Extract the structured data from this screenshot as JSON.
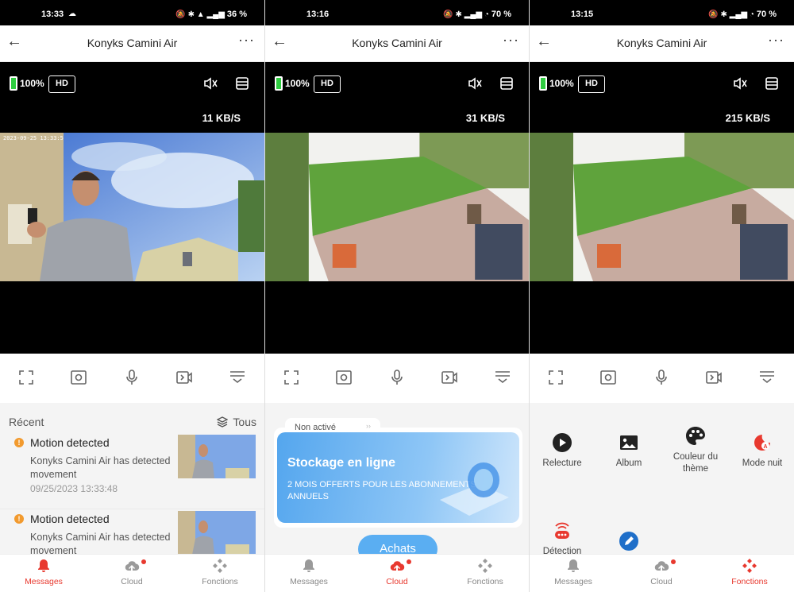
{
  "app": {
    "title": "Konyks Camini Air",
    "back_glyph": "←",
    "more_glyph": "···"
  },
  "colors": {
    "accent": "#e8392f",
    "battery": "#2ecc40",
    "cloud_button": "#5aaef2",
    "warning": "#f29a2e"
  },
  "screens": [
    {
      "status": {
        "time": "13:33",
        "extra": "☁",
        "glyphs": "🔕 ✱ ▲ ▂▄▆",
        "battery": "36 %"
      },
      "video": {
        "battery": "100%",
        "quality": "HD",
        "speed": "11 KB/S",
        "timestamp": "2023-09-25 13:33:5"
      }
    },
    {
      "status": {
        "time": "13:16",
        "extra": "",
        "glyphs": "🔕 ✱ ▂▄▆ ◔",
        "battery": "70 %"
      },
      "video": {
        "battery": "100%",
        "quality": "HD",
        "speed": "31 KB/S",
        "timestamp": ""
      }
    },
    {
      "status": {
        "time": "13:15",
        "extra": "",
        "glyphs": "🔕 ✱ ▂▄▆ ◔",
        "battery": "70 %"
      },
      "video": {
        "battery": "100%",
        "quality": "HD",
        "speed": "215 KB/S",
        "timestamp": ""
      }
    }
  ],
  "messages_view": {
    "section_label": "Récent",
    "filter_label": "Tous",
    "warn_glyph": "!",
    "items": [
      {
        "title": "Motion detected",
        "body": "Konyks Camini Air has detected movement",
        "time": "09/25/2023 13:33:48"
      },
      {
        "title": "Motion detected",
        "body": "Konyks Camini Air has detected movement",
        "time": ""
      }
    ]
  },
  "cloud_view": {
    "status_tab": "Non activé",
    "tab_chevron": "››",
    "card_title": "Stockage en ligne",
    "card_subtitle": "2 MOIS OFFERTS POUR LES ABONNEMENTS ANNUELS",
    "button": "Achats"
  },
  "functions_view": {
    "items": [
      {
        "label": "Relecture",
        "icon": "play-circle-icon"
      },
      {
        "label": "Album",
        "icon": "image-icon"
      },
      {
        "label": "Couleur du thème",
        "icon": "palette-icon"
      },
      {
        "label": "Mode nuit",
        "icon": "night-mode-icon"
      },
      {
        "label": "Détection",
        "icon": "detection-icon"
      },
      {
        "label": "",
        "icon": "edit-icon"
      }
    ]
  },
  "nav": {
    "messages": "Messages",
    "cloud": "Cloud",
    "functions": "Fonctions"
  }
}
